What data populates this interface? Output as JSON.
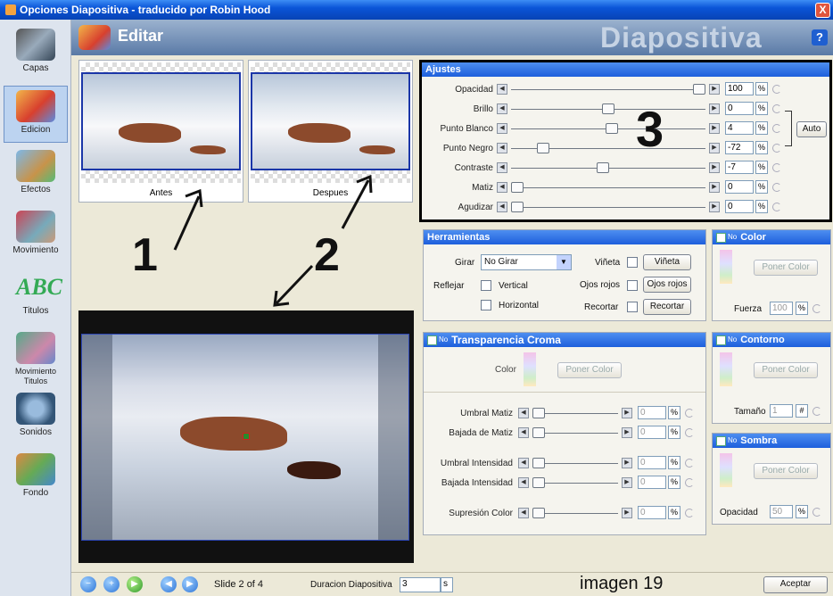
{
  "window": {
    "title": "Opciones Diapositiva - traducido por Robin Hood",
    "close": "X"
  },
  "sidebar": {
    "items": [
      {
        "label": "Capas",
        "icon": "film-icon"
      },
      {
        "label": "Edicion",
        "icon": "palette-icon",
        "selected": true
      },
      {
        "label": "Efectos",
        "icon": "effects-icon"
      },
      {
        "label": "Movimiento",
        "icon": "motion-icon"
      },
      {
        "label": "Titulos",
        "icon": "text-abc-icon"
      },
      {
        "label": "Movimiento Titulos",
        "icon": "text-motion-icon"
      },
      {
        "label": "Sonidos",
        "icon": "sound-icon"
      },
      {
        "label": "Fondo",
        "icon": "background-icon"
      }
    ]
  },
  "header": {
    "title": "Editar",
    "big_title": "Diapositiva",
    "help": "?"
  },
  "thumbs": {
    "before": "Antes",
    "after": "Despues"
  },
  "annotations": {
    "one": "1",
    "two": "2",
    "three": "3",
    "caption": "imagen 19"
  },
  "ajustes": {
    "title": "Ajustes",
    "auto": "Auto",
    "rows": [
      {
        "label": "Opacidad",
        "value": "100",
        "pct": "%",
        "pos": 1.0
      },
      {
        "label": "Brillo",
        "value": "0",
        "pct": "%",
        "pos": 0.5
      },
      {
        "label": "Punto Blanco",
        "value": "4",
        "pct": "%",
        "pos": 0.52
      },
      {
        "label": "Punto Negro",
        "value": "-72",
        "pct": "%",
        "pos": 0.14
      },
      {
        "label": "Contraste",
        "value": "-7",
        "pct": "%",
        "pos": 0.47
      },
      {
        "label": "Matiz",
        "value": "0",
        "pct": "%",
        "pos": 0.0
      },
      {
        "label": "Agudizar",
        "value": "0",
        "pct": "%",
        "pos": 0.0
      }
    ]
  },
  "herramientas": {
    "title": "Herramientas",
    "girar_label": "Girar",
    "girar_value": "No Girar",
    "reflejar_label": "Reflejar",
    "vertical": "Vertical",
    "horizontal": "Horizontal",
    "vineta": "Viñeta",
    "vineta_btn": "Viñeta",
    "ojos": "Ojos rojos",
    "ojos_btn": "Ojos rojos",
    "recortar": "Recortar",
    "recortar_btn": "Recortar"
  },
  "color": {
    "no": "No",
    "title": "Color",
    "poner": "Poner Color",
    "fuerza": "Fuerza",
    "fuerza_val": "100",
    "pct": "%"
  },
  "croma": {
    "no": "No",
    "title": "Transparencia Croma",
    "color": "Color",
    "poner": "Poner Color",
    "rows": [
      {
        "label": "Umbral Matiz",
        "value": "0",
        "pct": "%"
      },
      {
        "label": "Bajada de Matiz",
        "value": "0",
        "pct": "%"
      },
      {
        "label": "Umbral Intensidad",
        "value": "0",
        "pct": "%"
      },
      {
        "label": "Bajada Intensidad",
        "value": "0",
        "pct": "%"
      },
      {
        "label": "Supresión Color",
        "value": "0",
        "pct": "%"
      }
    ]
  },
  "contorno": {
    "no": "No",
    "title": "Contorno",
    "poner": "Poner Color",
    "tamano": "Tamaño",
    "tamano_val": "1",
    "hash": "#"
  },
  "sombra": {
    "no": "No",
    "title": "Sombra",
    "poner": "Poner Color",
    "opacidad": "Opacidad",
    "opacidad_val": "50",
    "pct": "%"
  },
  "bottom": {
    "slide": "Slide 2 of 4",
    "duracion": "Duracion Diapositiva",
    "duracion_val": "3",
    "unit": "s",
    "aceptar": "Aceptar"
  }
}
